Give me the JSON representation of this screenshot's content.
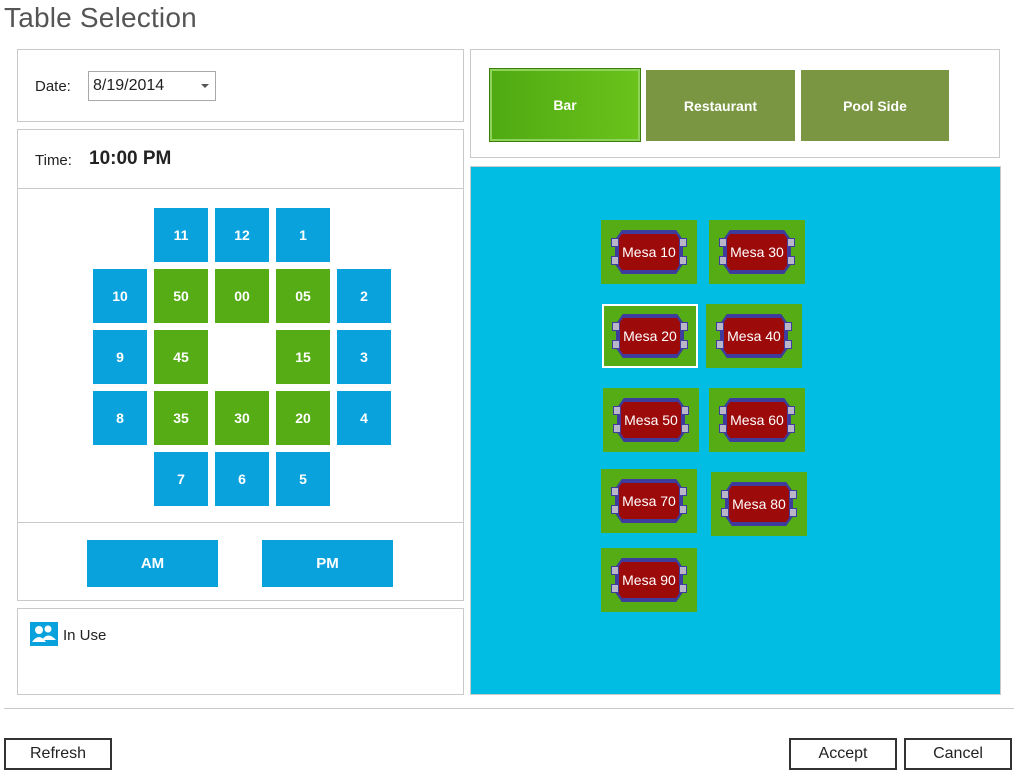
{
  "window": {
    "title": "Table Selection"
  },
  "date": {
    "label": "Date:",
    "value": "8/19/2014"
  },
  "time": {
    "label": "Time:",
    "value": "10:00 PM"
  },
  "clock": {
    "hours_top": [
      "11",
      "12",
      "1"
    ],
    "row2": [
      "10",
      "50",
      "00",
      "05",
      "2"
    ],
    "row3": [
      "9",
      "45",
      "15",
      "3"
    ],
    "row4": [
      "8",
      "35",
      "30",
      "20",
      "4"
    ],
    "hours_bottom": [
      "7",
      "6",
      "5"
    ]
  },
  "ampm": {
    "am": "AM",
    "pm": "PM"
  },
  "legend": {
    "in_use": "In Use"
  },
  "areas": {
    "bar": "Bar",
    "restaurant": "Restaurant",
    "pool_side": "Pool Side",
    "active": "Bar"
  },
  "tables": [
    {
      "name": "Mesa 10"
    },
    {
      "name": "Mesa 30"
    },
    {
      "name": "Mesa 20",
      "selected": true
    },
    {
      "name": "Mesa 40"
    },
    {
      "name": "Mesa 50"
    },
    {
      "name": "Mesa 60"
    },
    {
      "name": "Mesa 70"
    },
    {
      "name": "Mesa 80"
    },
    {
      "name": "Mesa 90"
    }
  ],
  "buttons": {
    "refresh": "Refresh",
    "accept": "Accept",
    "cancel": "Cancel"
  },
  "colors": {
    "blue_tile": "#0aa2dc",
    "green_tile": "#55ac14",
    "floor": "#01bde4",
    "area_button": "#7a9642",
    "table_top": "#9c0a0a"
  }
}
